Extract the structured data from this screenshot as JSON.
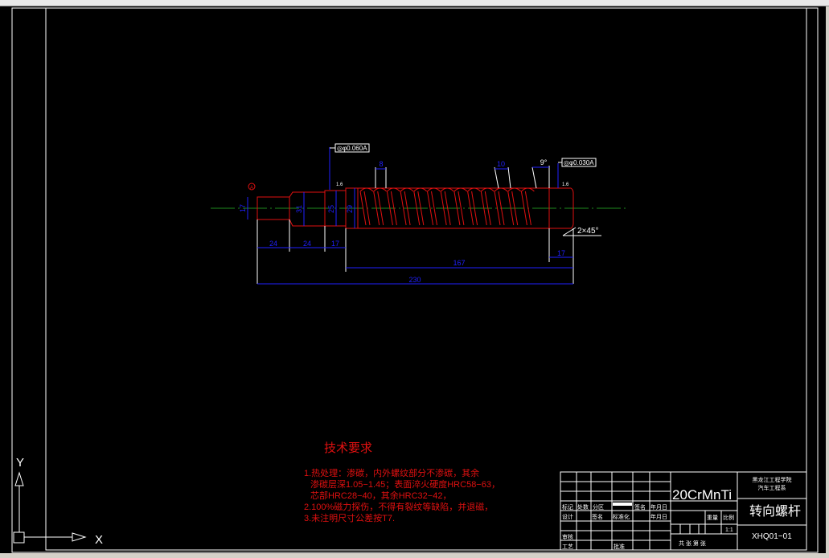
{
  "dims": {
    "d1": "17",
    "d2": "31",
    "d3": "25",
    "d4": "29",
    "l1": "24",
    "l2": "24",
    "l3": "17",
    "l4": "167",
    "l5": "17",
    "total": "230",
    "pitch": "8",
    "lead": "10",
    "angle": "9°",
    "chamfer": "2×45°"
  },
  "tolerances": {
    "t1": "◎φ0.060A",
    "t2": "◎φ0.030A",
    "datum": "A",
    "rough1": "1.6",
    "rough2": "1.6"
  },
  "tech_req": {
    "title": "技术要求",
    "l1": "1.热处理：渗碳，内外螺纹部分不渗碳，其余",
    "l2": "渗碳层深1.05−1.45；表面淬火硬度HRC58−63，",
    "l3": "芯部HRC28−40，其余HRC32−42，",
    "l4": "2.100%磁力探伤，不得有裂纹等缺陷，并退磁，",
    "l5": "3.未注明尺寸公差按T7."
  },
  "title_block": {
    "material": "20CrMnTi",
    "school": "黑龙江工程学院",
    "dept": "汽车工程系",
    "part": "转向螺杆",
    "code": "XHQ01−01",
    "scale": "1:1",
    "mark": "标记",
    "count": "处数",
    "zone": "分区",
    "sign": "签名",
    "date": "年月日",
    "design": "设计",
    "std": "标准化",
    "weight": "重量",
    "ratio": "比例",
    "review": "审核",
    "process": "工艺",
    "approve": "批准",
    "sheets": "共  张  第  张"
  },
  "ucs": {
    "x": "X",
    "y": "Y"
  },
  "colors": {
    "part": "#e01010",
    "dim": "#2020ff",
    "center": "#1e8a1e",
    "line": "#ffffff"
  }
}
